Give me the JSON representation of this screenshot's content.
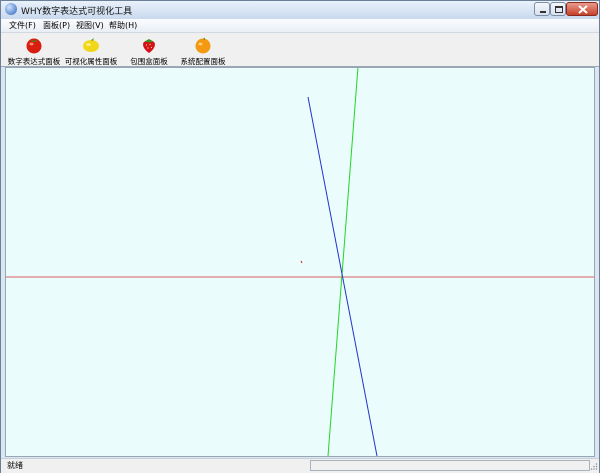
{
  "window": {
    "title": "WHY数字表达式可视化工具"
  },
  "menu": [
    {
      "id": "file",
      "label": "文件(F)"
    },
    {
      "id": "panel",
      "label": "面板(P)"
    },
    {
      "id": "view",
      "label": "视图(V)"
    },
    {
      "id": "help",
      "label": "帮助(H)"
    }
  ],
  "toolbar": [
    {
      "id": "math-expr",
      "label": "数字表达式面板",
      "icon": "tomato-icon"
    },
    {
      "id": "vis-props",
      "label": "可视化属性面板",
      "icon": "lemon-icon"
    },
    {
      "id": "bbox",
      "label": "包围盒面板",
      "icon": "strawberry-icon"
    },
    {
      "id": "sys-config",
      "label": "系统配置面板",
      "icon": "orange-icon"
    }
  ],
  "canvas": {
    "background": "#eafcfc",
    "axes": {
      "x_axis_color": "#e06060",
      "green_line_color": "#22d622",
      "blue_line_color": "#2233cc"
    }
  },
  "status": {
    "text": "就绪"
  }
}
